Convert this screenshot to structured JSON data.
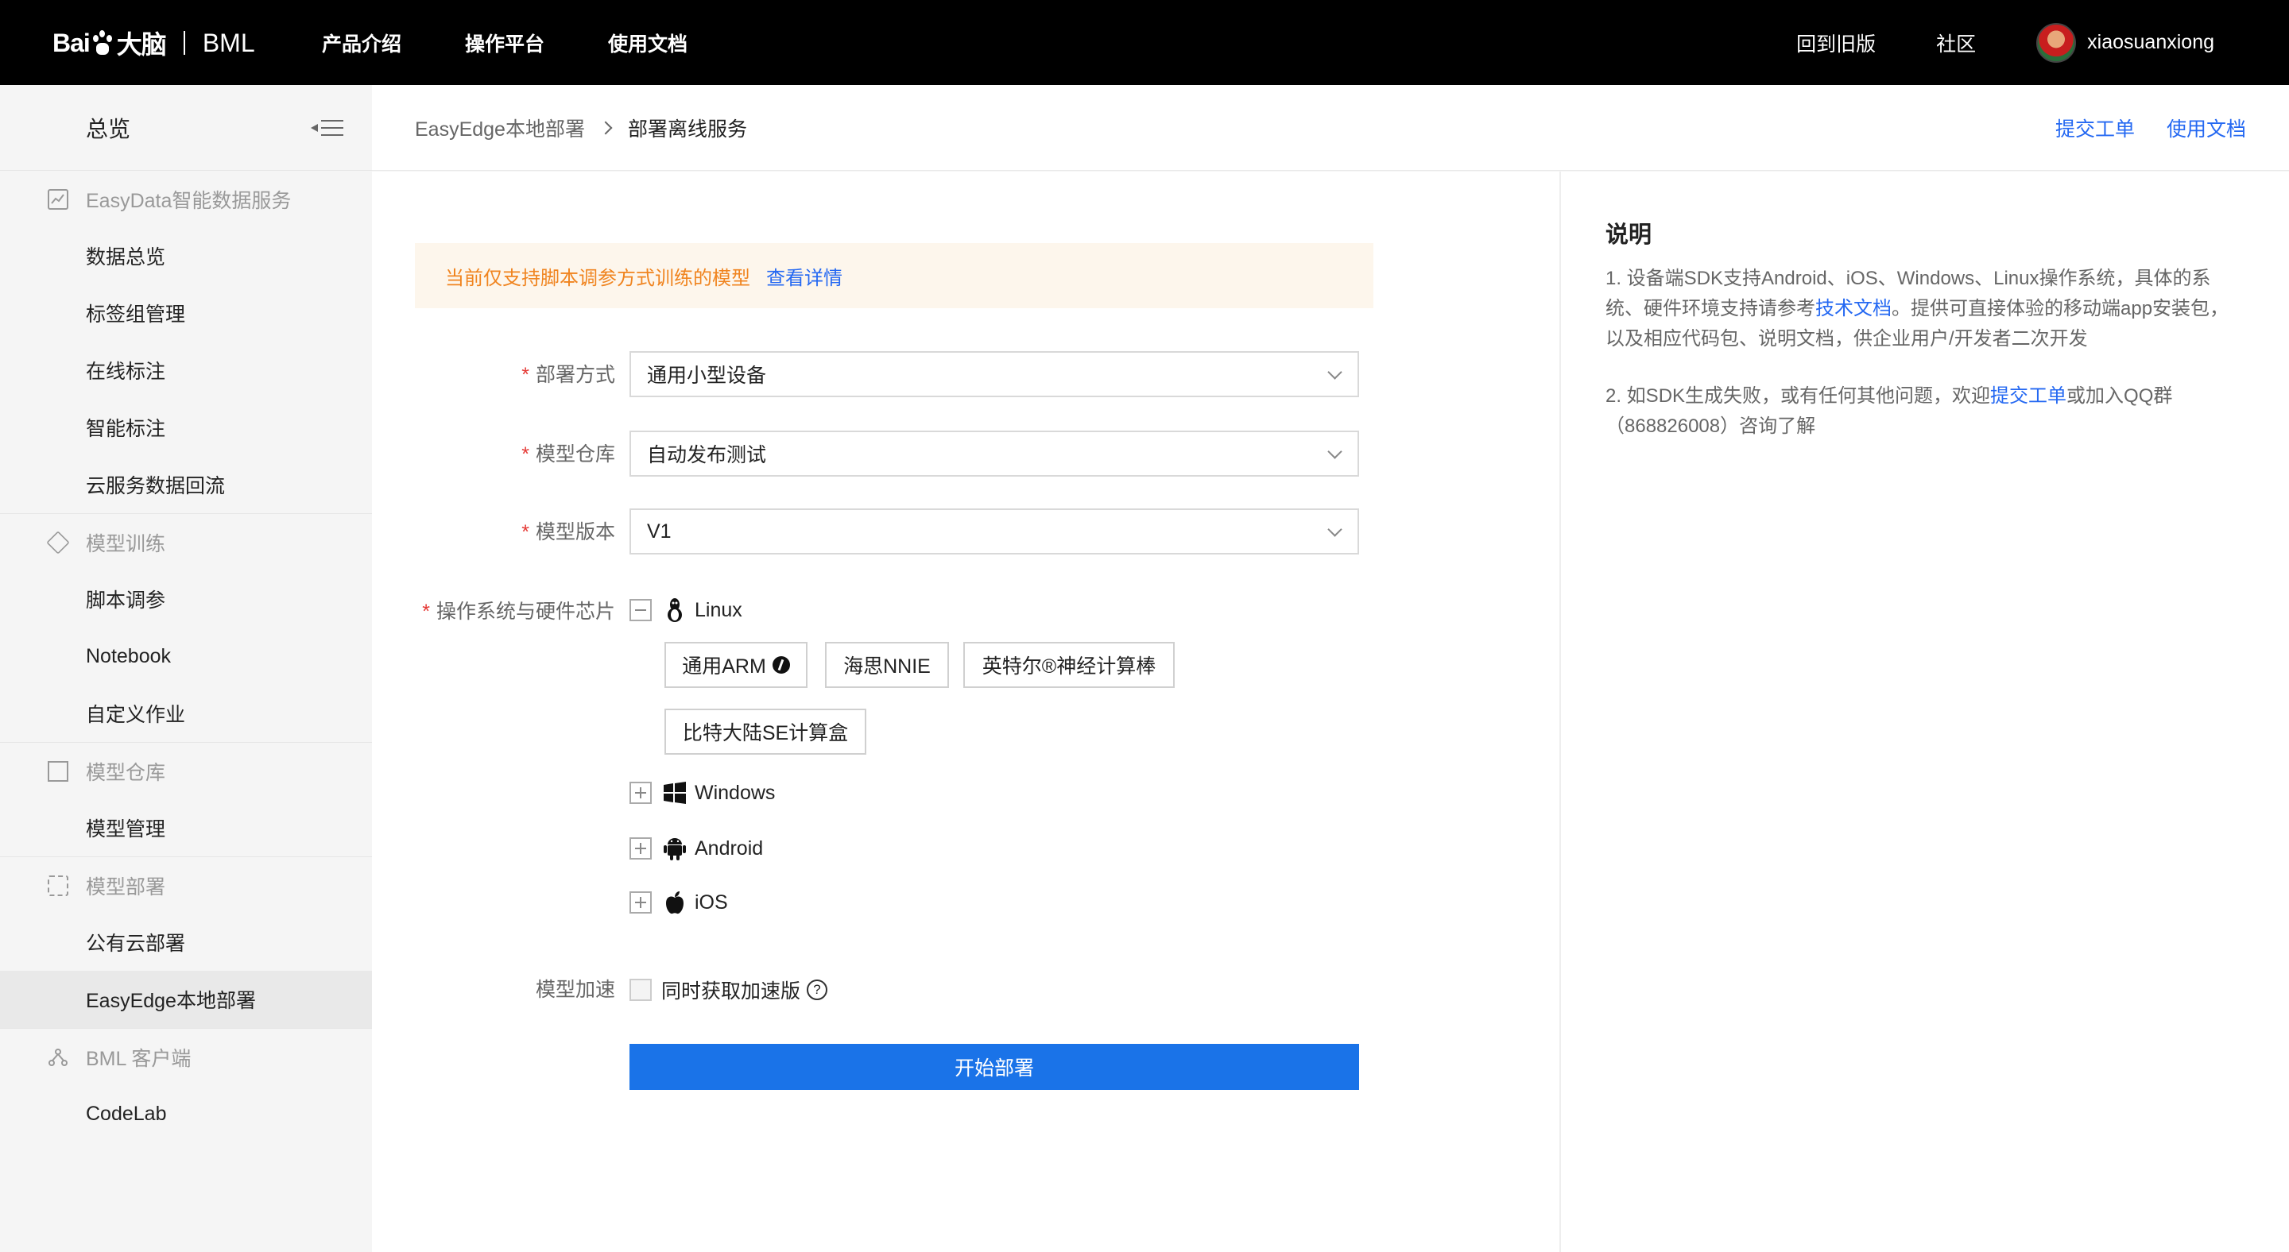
{
  "topbar": {
    "logo_text": "Bai",
    "logo_after": "大脑",
    "logo_product": "BML",
    "nav": [
      "产品介绍",
      "操作平台",
      "使用文档"
    ],
    "old_version": "回到旧版",
    "community": "社区",
    "username": "xiaosuanxiong"
  },
  "sidebar": {
    "overview": "总览",
    "sections": [
      {
        "title": "EasyData智能数据服务",
        "items": [
          "数据总览",
          "标签组管理",
          "在线标注",
          "智能标注",
          "云服务数据回流"
        ]
      },
      {
        "title": "模型训练",
        "items": [
          "脚本调参",
          "Notebook",
          "自定义作业"
        ]
      },
      {
        "title": "模型仓库",
        "items": [
          "模型管理"
        ]
      },
      {
        "title": "模型部署",
        "items": [
          "公有云部署",
          "EasyEdge本地部署"
        ]
      },
      {
        "title": "BML 客户端",
        "items": [
          "CodeLab"
        ]
      }
    ],
    "active_item": "EasyEdge本地部署"
  },
  "header": {
    "breadcrumb_parent": "EasyEdge本地部署",
    "breadcrumb_current": "部署离线服务",
    "link_ticket": "提交工单",
    "link_docs": "使用文档"
  },
  "notice": {
    "text": "当前仅支持脚本调参方式训练的模型",
    "link": "查看详情"
  },
  "form": {
    "deploy_method_label": "部署方式",
    "deploy_method_value": "通用小型设备",
    "model_repo_label": "模型仓库",
    "model_repo_value": "自动发布测试",
    "model_version_label": "模型版本",
    "model_version_value": "V1",
    "os_chip_label": "操作系统与硬件芯片",
    "os": {
      "linux": "Linux",
      "windows": "Windows",
      "android": "Android",
      "ios": "iOS"
    },
    "linux_chips": [
      "通用ARM",
      "海思NNIE",
      "英特尔®神经计算棒",
      "比特大陆SE计算盒"
    ],
    "accel_label": "模型加速",
    "accel_checkbox": "同时获取加速版",
    "accel_checked": false,
    "help_glyph": "?",
    "submit": "开始部署"
  },
  "info_panel": {
    "title": "说明",
    "p1_before": "1. 设备端SDK支持Android、iOS、Windows、Linux操作系统，具体的系统、硬件环境支持请参考",
    "p1_link": "技术文档",
    "p1_after": "。提供可直接体验的移动端app安装包，以及相应代码包、说明文档，供企业用户/开发者二次开发",
    "p2_before": "2. 如SDK生成失败，或有任何其他问题，欢迎",
    "p2_link": "提交工单",
    "p2_after": "或加入QQ群（868826008）咨询了解"
  },
  "colors": {
    "topbar_bg": "#000000",
    "accent": "#2468f2",
    "button_bg": "#1a73e8",
    "notice_text": "#f0841f",
    "notice_bg": "#fdf6ec",
    "required": "#e53935"
  }
}
